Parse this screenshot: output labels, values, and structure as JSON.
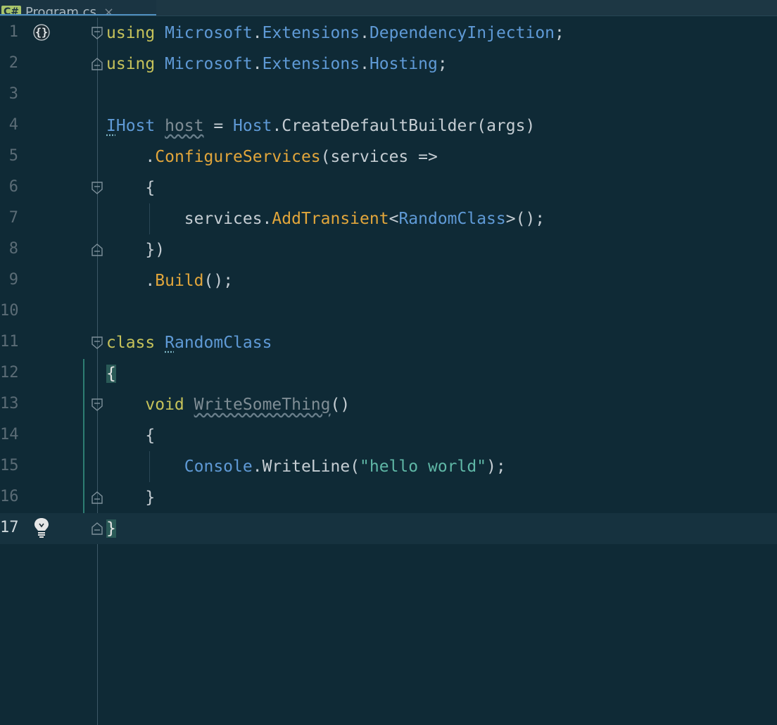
{
  "tab": {
    "lang_badge": "C#",
    "filename": "Program.cs",
    "close": "×"
  },
  "gutter_icons": {
    "line1": "namespace-braces-icon",
    "line17": "lightbulb-icon"
  },
  "lines": [
    {
      "n": "1",
      "parts": [
        [
          "kw",
          "using"
        ],
        [
          "plain",
          " "
        ],
        [
          "ns",
          "Microsoft"
        ],
        [
          "plain",
          "."
        ],
        [
          "ns",
          "Extensions"
        ],
        [
          "plain",
          "."
        ],
        [
          "ns",
          "DependencyInjection"
        ],
        [
          "plain",
          ";"
        ]
      ]
    },
    {
      "n": "2",
      "parts": [
        [
          "kw",
          "using"
        ],
        [
          "plain",
          " "
        ],
        [
          "ns",
          "Microsoft"
        ],
        [
          "plain",
          "."
        ],
        [
          "ns",
          "Extensions"
        ],
        [
          "plain",
          "."
        ],
        [
          "ns",
          "Hosting"
        ],
        [
          "plain",
          ";"
        ]
      ]
    },
    {
      "n": "3",
      "parts": []
    },
    {
      "n": "4",
      "parts": [
        [
          "type dots",
          "I"
        ],
        [
          "type",
          "Host"
        ],
        [
          "plain",
          " "
        ],
        [
          "dim squig",
          "host"
        ],
        [
          "plain",
          " = "
        ],
        [
          "type",
          "Host"
        ],
        [
          "plain",
          ".CreateDefaultBuilder(args)"
        ]
      ]
    },
    {
      "n": "5",
      "parts": [
        [
          "plain",
          "    ."
        ],
        [
          "method",
          "ConfigureServices"
        ],
        [
          "plain",
          "(services =>"
        ]
      ]
    },
    {
      "n": "6",
      "parts": [
        [
          "plain",
          "    {"
        ]
      ]
    },
    {
      "n": "7",
      "parts": [
        [
          "plain",
          "        services."
        ],
        [
          "method",
          "AddTransient"
        ],
        [
          "plain",
          "<"
        ],
        [
          "type",
          "RandomClass"
        ],
        [
          "plain",
          ">();"
        ]
      ]
    },
    {
      "n": "8",
      "parts": [
        [
          "plain",
          "    })"
        ]
      ]
    },
    {
      "n": "9",
      "parts": [
        [
          "plain",
          "    ."
        ],
        [
          "method",
          "Build"
        ],
        [
          "plain",
          "();"
        ]
      ]
    },
    {
      "n": "10",
      "parts": []
    },
    {
      "n": "11",
      "parts": [
        [
          "kw",
          "class"
        ],
        [
          "plain",
          " "
        ],
        [
          "type dots",
          "R"
        ],
        [
          "type",
          "andomClass"
        ]
      ]
    },
    {
      "n": "12",
      "parts": [
        [
          "brace-hl",
          "{"
        ]
      ]
    },
    {
      "n": "13",
      "parts": [
        [
          "plain",
          "    "
        ],
        [
          "kw",
          "void"
        ],
        [
          "plain",
          " "
        ],
        [
          "dim squig",
          "WriteSomeThing"
        ],
        [
          "plain",
          "()"
        ]
      ]
    },
    {
      "n": "14",
      "parts": [
        [
          "plain",
          "    {"
        ]
      ]
    },
    {
      "n": "15",
      "parts": [
        [
          "plain",
          "        "
        ],
        [
          "type",
          "Console"
        ],
        [
          "plain",
          ".WriteLine("
        ],
        [
          "str",
          "\"hello world\""
        ],
        [
          "plain",
          ");"
        ]
      ]
    },
    {
      "n": "16",
      "parts": [
        [
          "plain",
          "    }"
        ]
      ]
    },
    {
      "n": "17",
      "parts": [
        [
          "brace-hl",
          "}"
        ]
      ]
    }
  ]
}
